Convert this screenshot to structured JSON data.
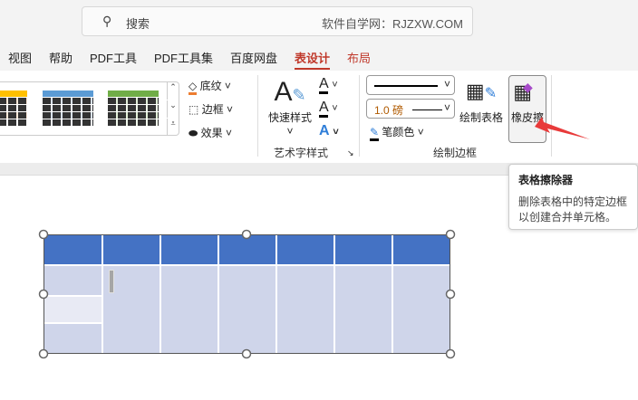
{
  "search": {
    "placeholder": "搜索",
    "site": "软件自学网：RJZXW.COM"
  },
  "tabs": [
    {
      "label": "视图"
    },
    {
      "label": "帮助"
    },
    {
      "label": "PDF工具"
    },
    {
      "label": "PDF工具集"
    },
    {
      "label": "百度网盘"
    },
    {
      "label": "表设计",
      "active": true
    },
    {
      "label": "布局"
    }
  ],
  "ribbon": {
    "shading": "底纹",
    "borders": "边框",
    "effects": "效果",
    "quick_styles": "快速样式",
    "wordart_group": "艺术字样式",
    "line_weight": "1.0 磅",
    "pen_color": "笔颜色",
    "draw_table": "绘制表格",
    "eraser": "橡皮擦",
    "draw_borders_group": "绘制边框"
  },
  "tooltip": {
    "title": "表格擦除器",
    "desc_line1": "删除表格中的特定边框",
    "desc_line2": "以创建合并单元格。"
  },
  "colors": {
    "accent": "#c0392b",
    "table_header": "#4472c4",
    "table_body": "#cfd5ea",
    "arrow": "#e83a3a"
  }
}
